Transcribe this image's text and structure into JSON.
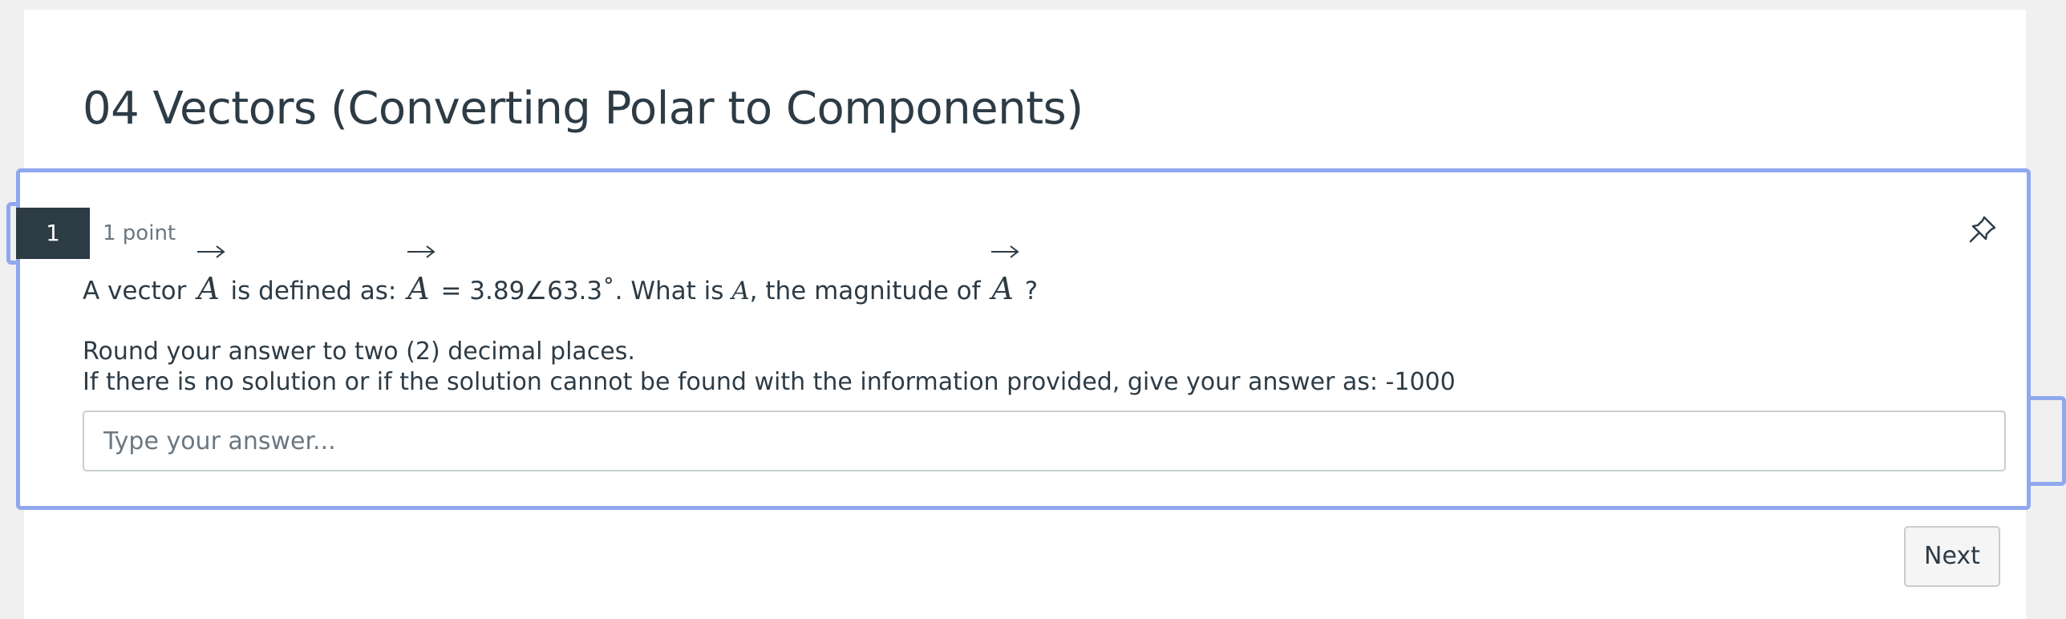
{
  "quiz": {
    "title": "04 Vectors (Converting Polar to Components)"
  },
  "question": {
    "number": "1",
    "points": "1 point",
    "pin_icon": "pin-icon",
    "text": {
      "part1": "A vector ",
      "vec_symbol": "A",
      "part2": " is defined as: ",
      "part3": " = 3.89∠63.3˚. What is ",
      "magnitude_symbol": "A",
      "part4": ", the magnitude of ",
      "part5": " ?"
    },
    "instructions": [
      "Round your answer to two (2) decimal places.",
      "If there is no solution or if the solution cannot be found with the information provided, give your answer as: -1000"
    ],
    "answer": {
      "value": "",
      "placeholder": "Type your answer..."
    }
  },
  "navigation": {
    "next_label": "Next"
  },
  "colors": {
    "focus_border": "#8fa8ee",
    "number_badge": "#2d3b45",
    "text": "#2d3b45",
    "muted": "#6b7780"
  }
}
